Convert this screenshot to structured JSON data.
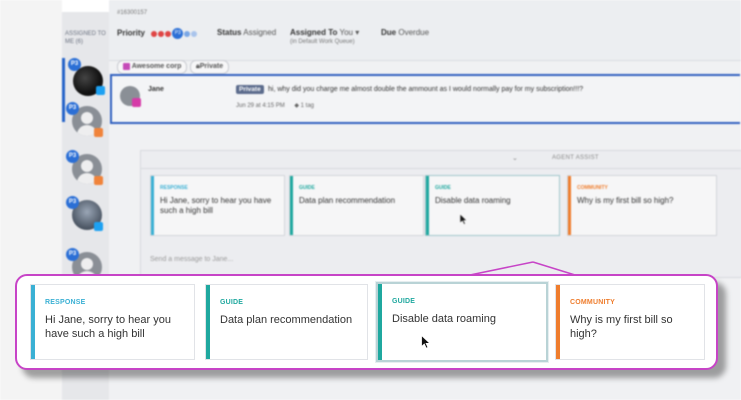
{
  "ticket": {
    "id": "#16300157"
  },
  "rail": {
    "label": "ASSIGNED TO ME (6)",
    "badge": "P3"
  },
  "header": {
    "priority_label": "Priority",
    "priority_badge": "P3",
    "status_label": "Status",
    "status_value": "Assigned",
    "assigned_label": "Assigned To",
    "assigned_value": "You",
    "assigned_sub": "(in Default Work Queue)",
    "due_label": "Due",
    "due_value": "Overdue"
  },
  "tags": {
    "company": "Awesome corp",
    "private": "Private"
  },
  "message": {
    "author": "Jane",
    "private_tag": "Private",
    "text": "hi, why did you charge me almost double the ammount as I would normally pay for my subscription!!!?",
    "time": "Jun 29 at 4:15 PM",
    "tags": "1 tag"
  },
  "agent_assist": {
    "title": "AGENT ASSIST",
    "compose_placeholder": "Send a message to Jane...",
    "cards": [
      {
        "category": "RESPONSE",
        "text": "Hi Jane, sorry to hear you have such a high bill",
        "color": "#3ab0d4"
      },
      {
        "category": "GUIDE",
        "text": "Data plan recommendation",
        "color": "#1fa89f"
      },
      {
        "category": "GUIDE",
        "text": "Disable data roaming",
        "color": "#1fa89f"
      },
      {
        "category": "COMMUNITY",
        "text": "Why is my first bill so high?",
        "color": "#ef7d2d"
      }
    ]
  },
  "colors": {
    "accent": "#2f5fbf",
    "callout_border": "#c744c7"
  }
}
